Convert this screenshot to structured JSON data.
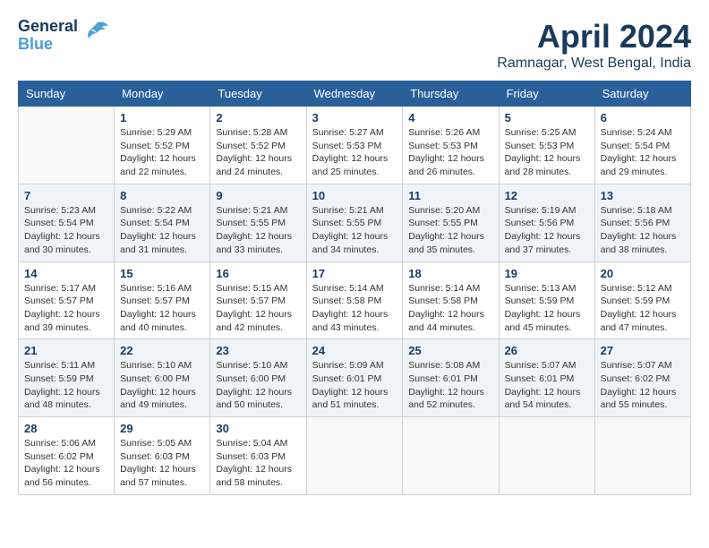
{
  "header": {
    "logo_line1": "General",
    "logo_line2": "Blue",
    "month_title": "April 2024",
    "location": "Ramnagar, West Bengal, India"
  },
  "columns": [
    "Sunday",
    "Monday",
    "Tuesday",
    "Wednesday",
    "Thursday",
    "Friday",
    "Saturday"
  ],
  "weeks": [
    [
      {
        "day": "",
        "sunrise": "",
        "sunset": "",
        "daylight": ""
      },
      {
        "day": "1",
        "sunrise": "5:29 AM",
        "sunset": "5:52 PM",
        "daylight": "12 hours and 22 minutes."
      },
      {
        "day": "2",
        "sunrise": "5:28 AM",
        "sunset": "5:52 PM",
        "daylight": "12 hours and 24 minutes."
      },
      {
        "day": "3",
        "sunrise": "5:27 AM",
        "sunset": "5:53 PM",
        "daylight": "12 hours and 25 minutes."
      },
      {
        "day": "4",
        "sunrise": "5:26 AM",
        "sunset": "5:53 PM",
        "daylight": "12 hours and 26 minutes."
      },
      {
        "day": "5",
        "sunrise": "5:25 AM",
        "sunset": "5:53 PM",
        "daylight": "12 hours and 28 minutes."
      },
      {
        "day": "6",
        "sunrise": "5:24 AM",
        "sunset": "5:54 PM",
        "daylight": "12 hours and 29 minutes."
      }
    ],
    [
      {
        "day": "7",
        "sunrise": "5:23 AM",
        "sunset": "5:54 PM",
        "daylight": "12 hours and 30 minutes."
      },
      {
        "day": "8",
        "sunrise": "5:22 AM",
        "sunset": "5:54 PM",
        "daylight": "12 hours and 31 minutes."
      },
      {
        "day": "9",
        "sunrise": "5:21 AM",
        "sunset": "5:55 PM",
        "daylight": "12 hours and 33 minutes."
      },
      {
        "day": "10",
        "sunrise": "5:21 AM",
        "sunset": "5:55 PM",
        "daylight": "12 hours and 34 minutes."
      },
      {
        "day": "11",
        "sunrise": "5:20 AM",
        "sunset": "5:55 PM",
        "daylight": "12 hours and 35 minutes."
      },
      {
        "day": "12",
        "sunrise": "5:19 AM",
        "sunset": "5:56 PM",
        "daylight": "12 hours and 37 minutes."
      },
      {
        "day": "13",
        "sunrise": "5:18 AM",
        "sunset": "5:56 PM",
        "daylight": "12 hours and 38 minutes."
      }
    ],
    [
      {
        "day": "14",
        "sunrise": "5:17 AM",
        "sunset": "5:57 PM",
        "daylight": "12 hours and 39 minutes."
      },
      {
        "day": "15",
        "sunrise": "5:16 AM",
        "sunset": "5:57 PM",
        "daylight": "12 hours and 40 minutes."
      },
      {
        "day": "16",
        "sunrise": "5:15 AM",
        "sunset": "5:57 PM",
        "daylight": "12 hours and 42 minutes."
      },
      {
        "day": "17",
        "sunrise": "5:14 AM",
        "sunset": "5:58 PM",
        "daylight": "12 hours and 43 minutes."
      },
      {
        "day": "18",
        "sunrise": "5:14 AM",
        "sunset": "5:58 PM",
        "daylight": "12 hours and 44 minutes."
      },
      {
        "day": "19",
        "sunrise": "5:13 AM",
        "sunset": "5:59 PM",
        "daylight": "12 hours and 45 minutes."
      },
      {
        "day": "20",
        "sunrise": "5:12 AM",
        "sunset": "5:59 PM",
        "daylight": "12 hours and 47 minutes."
      }
    ],
    [
      {
        "day": "21",
        "sunrise": "5:11 AM",
        "sunset": "5:59 PM",
        "daylight": "12 hours and 48 minutes."
      },
      {
        "day": "22",
        "sunrise": "5:10 AM",
        "sunset": "6:00 PM",
        "daylight": "12 hours and 49 minutes."
      },
      {
        "day": "23",
        "sunrise": "5:10 AM",
        "sunset": "6:00 PM",
        "daylight": "12 hours and 50 minutes."
      },
      {
        "day": "24",
        "sunrise": "5:09 AM",
        "sunset": "6:01 PM",
        "daylight": "12 hours and 51 minutes."
      },
      {
        "day": "25",
        "sunrise": "5:08 AM",
        "sunset": "6:01 PM",
        "daylight": "12 hours and 52 minutes."
      },
      {
        "day": "26",
        "sunrise": "5:07 AM",
        "sunset": "6:01 PM",
        "daylight": "12 hours and 54 minutes."
      },
      {
        "day": "27",
        "sunrise": "5:07 AM",
        "sunset": "6:02 PM",
        "daylight": "12 hours and 55 minutes."
      }
    ],
    [
      {
        "day": "28",
        "sunrise": "5:06 AM",
        "sunset": "6:02 PM",
        "daylight": "12 hours and 56 minutes."
      },
      {
        "day": "29",
        "sunrise": "5:05 AM",
        "sunset": "6:03 PM",
        "daylight": "12 hours and 57 minutes."
      },
      {
        "day": "30",
        "sunrise": "5:04 AM",
        "sunset": "6:03 PM",
        "daylight": "12 hours and 58 minutes."
      },
      {
        "day": "",
        "sunrise": "",
        "sunset": "",
        "daylight": ""
      },
      {
        "day": "",
        "sunrise": "",
        "sunset": "",
        "daylight": ""
      },
      {
        "day": "",
        "sunrise": "",
        "sunset": "",
        "daylight": ""
      },
      {
        "day": "",
        "sunrise": "",
        "sunset": "",
        "daylight": ""
      }
    ]
  ]
}
